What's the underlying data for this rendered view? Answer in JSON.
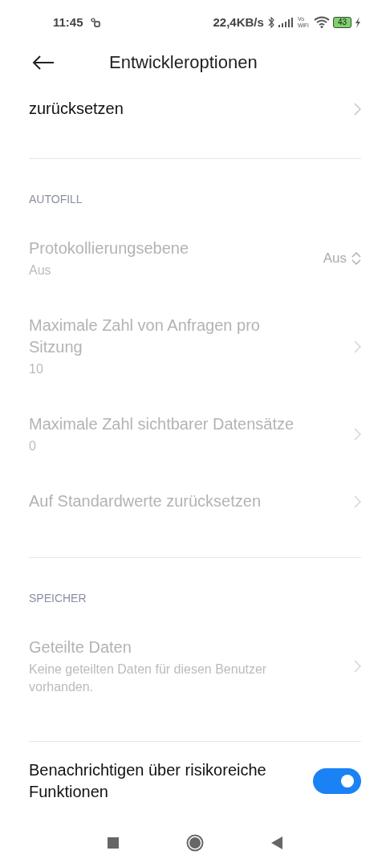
{
  "status_bar": {
    "time": "11:45",
    "speed": "22,4KB/s",
    "vowifi": [
      "Vo",
      "WiFi"
    ],
    "battery": "43",
    "charging": true
  },
  "header": {
    "title": "Entwickleroptionen"
  },
  "sections": [
    {
      "items": [
        {
          "kind": "link",
          "title": "zurücksetzen",
          "disabled": false
        }
      ]
    },
    {
      "header": "AUTOFILL",
      "items": [
        {
          "kind": "dropdown",
          "title": "Protokollierungsebene",
          "subtitle": "Aus",
          "value": "Aus",
          "disabled": true
        },
        {
          "kind": "link",
          "title": "Maximale Zahl von Anfragen pro Sitzung",
          "subtitle": "10",
          "disabled": true
        },
        {
          "kind": "link",
          "title": "Maximale Zahl sichtbarer Datensätze",
          "subtitle": "0",
          "disabled": true
        },
        {
          "kind": "link",
          "title": "Auf Standardwerte zurücksetzen",
          "disabled": true
        }
      ]
    },
    {
      "header": "SPEICHER",
      "items": [
        {
          "kind": "link",
          "title": "Geteilte Daten",
          "subtitle": "Keine geteilten Daten für diesen Benutzer vorhanden.",
          "disabled": true
        }
      ]
    },
    {
      "items": [
        {
          "kind": "toggle",
          "title": "Benachrichtigen über risikoreiche Funktionen",
          "on": true,
          "disabled": false
        }
      ]
    }
  ]
}
